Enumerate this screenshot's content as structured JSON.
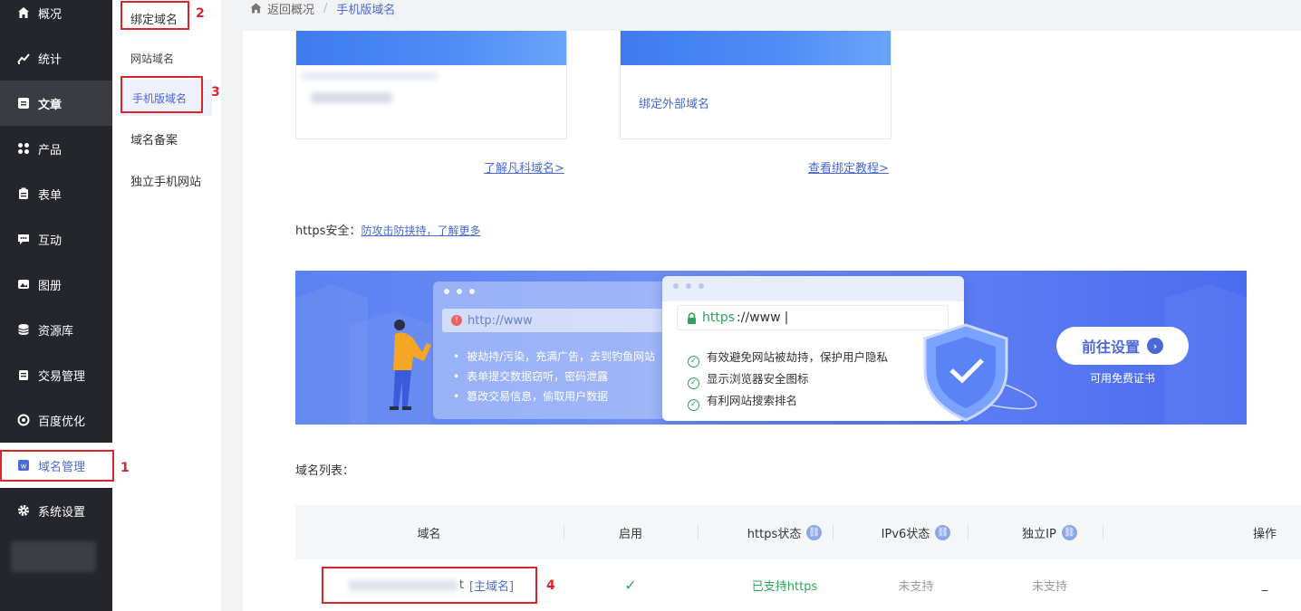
{
  "sidebar": {
    "items": [
      {
        "label": "概况",
        "icon": "home-icon"
      },
      {
        "label": "统计",
        "icon": "chart-icon"
      },
      {
        "label": "文章",
        "icon": "article-icon"
      },
      {
        "label": "产品",
        "icon": "grid-icon"
      },
      {
        "label": "表单",
        "icon": "form-icon"
      },
      {
        "label": "互动",
        "icon": "chat-icon"
      },
      {
        "label": "图册",
        "icon": "album-icon"
      },
      {
        "label": "资源库",
        "icon": "database-icon"
      },
      {
        "label": "交易管理",
        "icon": "trade-icon"
      },
      {
        "label": "百度优化",
        "icon": "seo-icon"
      },
      {
        "label": "域名管理",
        "icon": "domain-icon"
      },
      {
        "label": "系统设置",
        "icon": "gear-icon"
      }
    ]
  },
  "submenu": {
    "items": [
      "绑定域名",
      "网站域名",
      "手机版域名",
      "域名备案",
      "独立手机网站"
    ]
  },
  "annotations": [
    "1",
    "2",
    "3",
    "4"
  ],
  "breadcrumb": {
    "back": "返回概况",
    "separator": "/",
    "current": "手机版域名"
  },
  "cards": {
    "bind_external": "绑定外部域名",
    "learn_link": "了解凡科域名>",
    "tutorial_link": "查看绑定教程>"
  },
  "https": {
    "label": "https安全：",
    "link": "防攻击防挟持，了解更多"
  },
  "banner": {
    "bad_url": "http://www",
    "bad_points": [
      "被劫持/污染，充满广告，去到钓鱼网站",
      "表单提交数据窃听，密码泄露",
      "篡改交易信息，偷取用户数据"
    ],
    "good_url_scheme": "https",
    "good_url_rest": "://www",
    "good_points": [
      "有效避免网站被劫持，保护用户隐私",
      "显示浏览器安全图标",
      "有利网站搜索排名"
    ],
    "button": "前往设置",
    "button_sub": "可用免费证书"
  },
  "domain_list": {
    "title": "域名列表：",
    "columns": [
      "域名",
      "启用",
      "https状态",
      "IPv6状态",
      "独立IP",
      "操作"
    ],
    "rows": [
      {
        "domain_suffix": "t",
        "main_tag": "[主域名]",
        "enabled": "✓",
        "https": "已支持https",
        "ipv6": "未支持",
        "ip": "未支持",
        "op": "_"
      }
    ]
  },
  "colors": {
    "accent": "#4a68d8",
    "annotation": "#d9262e",
    "success": "#2aa55a",
    "sidebar_bg": "#24262b"
  }
}
